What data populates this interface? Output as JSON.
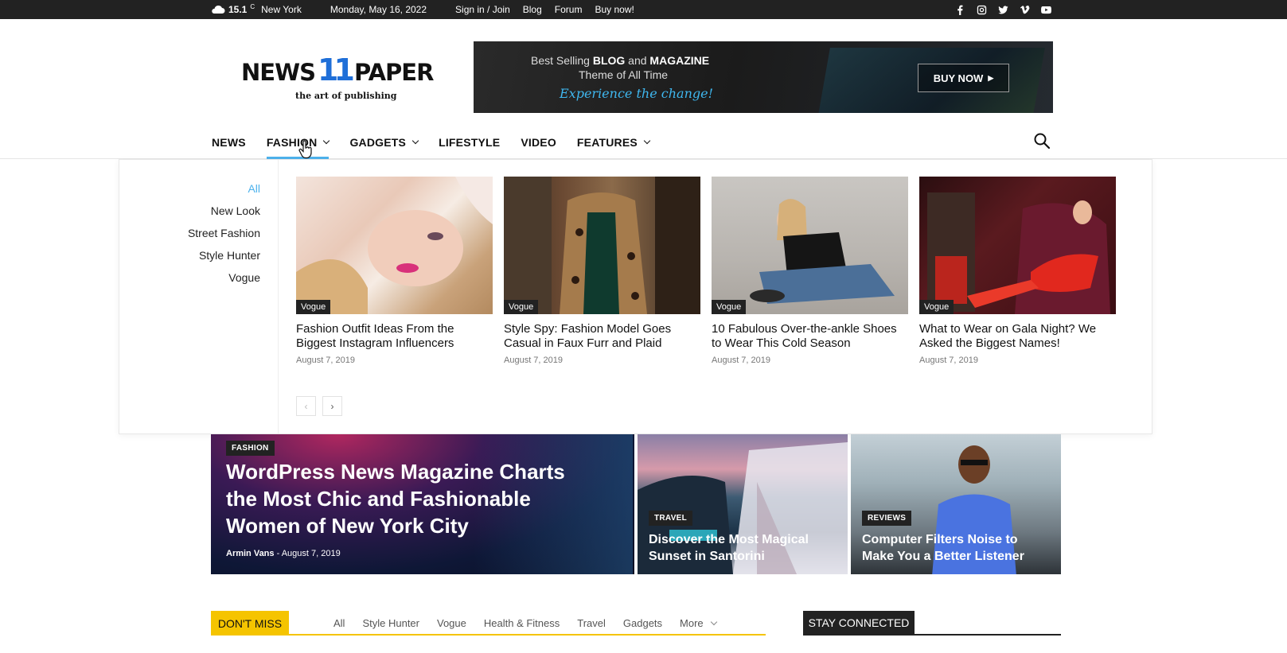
{
  "topbar": {
    "temp": "15.1",
    "unit": "C",
    "city": "New York",
    "date": "Monday, May 16, 2022",
    "links": [
      "Sign in / Join",
      "Blog",
      "Forum",
      "Buy now!"
    ],
    "socials": [
      "facebook-icon",
      "instagram-icon",
      "twitter-icon",
      "vimeo-icon",
      "youtube-icon"
    ]
  },
  "logo": {
    "word1": "NEWS",
    "num": "11",
    "word2": "PAPER",
    "tagline": "the art of publishing"
  },
  "banner": {
    "line1_a": "Best Selling ",
    "line1_b": "BLOG",
    "line1_c": " and ",
    "line1_d": "MAGAZINE",
    "line2": "Theme of All Time",
    "line3": "Experience the change!",
    "button": "BUY NOW"
  },
  "nav": {
    "items": [
      "NEWS",
      "FASHION",
      "GADGETS",
      "LIFESTYLE",
      "VIDEO",
      "FEATURES"
    ]
  },
  "megamenu": {
    "subcats": [
      "All",
      "New Look",
      "Street Fashion",
      "Style Hunter",
      "Vogue"
    ],
    "cards": [
      {
        "cat": "Vogue",
        "title": "Fashion Outfit Ideas From the Biggest Instagram Influencers",
        "date": "August 7, 2019"
      },
      {
        "cat": "Vogue",
        "title": "Style Spy: Fashion Model Goes Casual in Faux Furr and Plaid",
        "date": "August 7, 2019"
      },
      {
        "cat": "Vogue",
        "title": "10 Fabulous Over-the-ankle Shoes to Wear This Cold Season",
        "date": "August 7, 2019"
      },
      {
        "cat": "Vogue",
        "title": "What to Wear on Gala Night? We Asked the Biggest Names!",
        "date": "August 7, 2019"
      }
    ]
  },
  "hero": {
    "cat": "FASHION",
    "title": "WordPress News Magazine Charts the Most Chic and Fashionable Women of New York City",
    "author": "Armin Vans",
    "sep": "-",
    "date": "August 7, 2019"
  },
  "tiles": [
    {
      "cat": "TRAVEL",
      "title": "Discover the Most Magical Sunset in Santorini"
    },
    {
      "cat": "REVIEWS",
      "title": "Computer Filters Noise to Make You a Better Listener"
    }
  ],
  "dont_miss": {
    "label": "DON'T MISS",
    "tabs": [
      "All",
      "Style Hunter",
      "Vogue",
      "Health & Fitness",
      "Travel",
      "Gadgets"
    ],
    "more": "More"
  },
  "stay_connected": {
    "label": "STAY CONNECTED"
  }
}
